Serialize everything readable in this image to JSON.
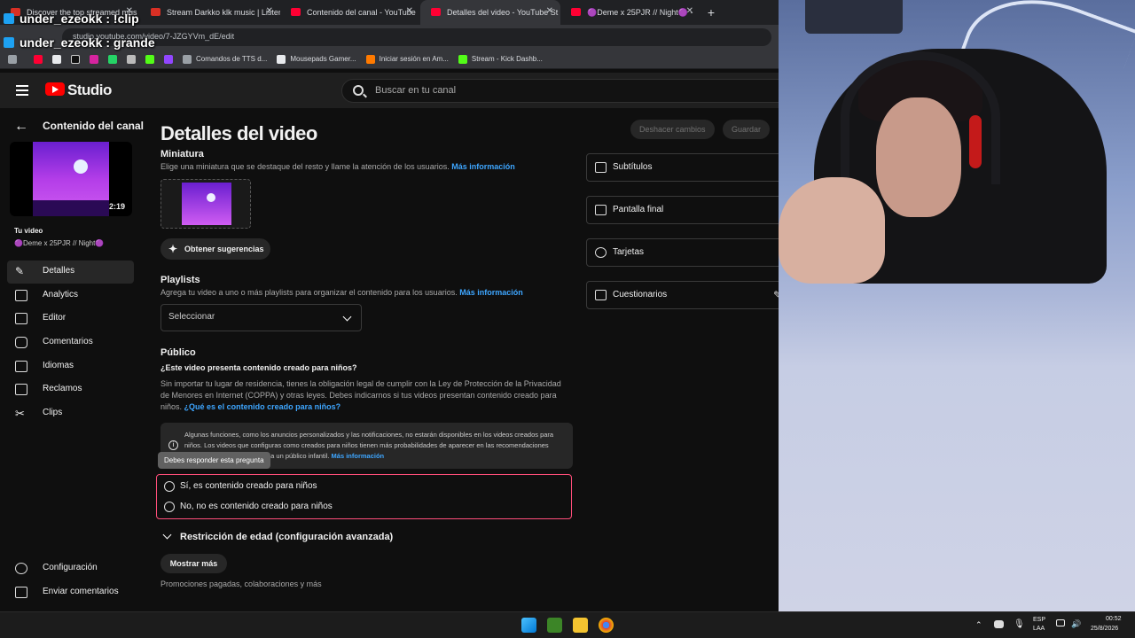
{
  "browser": {
    "tabs": [
      {
        "label": "Discover the top streamed mus",
        "color": "#d93025",
        "active": false
      },
      {
        "label": "Stream Darkko klk music | Listen",
        "color": "#d93025",
        "active": false
      },
      {
        "label": "Contenido del canal - YouTube",
        "color": "#ff0033",
        "active": false
      },
      {
        "label": "Detalles del video - YouTube St",
        "color": "#ff0033",
        "active": true
      },
      {
        "label": "🟣Deme x 25PJR // Night🟣 -",
        "color": "#ff0033",
        "active": false
      }
    ],
    "new_tab": "+",
    "url": "studio.youtube.com/video/7-JZGYVm_dE/edit",
    "bookmarks": [
      "Comandos de TTS d...",
      "Mousepads Gamer...",
      "Iniciar sesión en Am...",
      "Stream - Kick Dashb..."
    ]
  },
  "chat_overlay": [
    {
      "user": "under_ezeokk",
      "message": ": !clip"
    },
    {
      "user": "under_ezeokk",
      "message": ": grande"
    }
  ],
  "studio": {
    "logo_text": "Studio",
    "search_placeholder": "Buscar en tu canal",
    "sidebar": {
      "back_title": "Contenido del canal",
      "duration": "2:19",
      "your_video": "Tu video",
      "video_title": "🟣Deme x 25PJR // Night🟣",
      "nav": [
        {
          "label": "Detalles",
          "icon": "pencil-icon",
          "selected": true
        },
        {
          "label": "Analytics",
          "icon": "analytics-icon",
          "selected": false
        },
        {
          "label": "Editor",
          "icon": "editor-icon",
          "selected": false
        },
        {
          "label": "Comentarios",
          "icon": "comments-icon",
          "selected": false
        },
        {
          "label": "Idiomas",
          "icon": "subtitles-icon",
          "selected": false
        },
        {
          "label": "Reclamos",
          "icon": "copyright-icon",
          "selected": false
        },
        {
          "label": "Clips",
          "icon": "scissors-icon",
          "selected": false
        }
      ],
      "bottom": [
        {
          "label": "Configuración",
          "icon": "gear-icon"
        },
        {
          "label": "Enviar comentarios",
          "icon": "feedback-icon"
        }
      ]
    },
    "main": {
      "title": "Detalles del video",
      "undo_label": "Deshacer cambios",
      "save_label": "Guardar",
      "thumbnail": {
        "title": "Miniatura",
        "desc": "Elige una miniatura que se destaque del resto y llame la atención de los usuarios.",
        "link": "Más información",
        "suggestions_label": "Obtener sugerencias"
      },
      "playlists": {
        "title": "Playlists",
        "desc": "Agrega tu video a uno o más playlists para organizar el contenido para los usuarios.",
        "link": "Más información",
        "select_value": "Seleccionar"
      },
      "audience": {
        "title": "Público",
        "question": "¿Este video presenta contenido creado para niños?",
        "desc": "Sin importar tu lugar de residencia, tienes la obligación legal de cumplir con la Ley de Protección de la Privacidad de Menores en Internet (COPPA) y otras leyes. Debes indicarnos si tus videos presentan contenido creado para niños.",
        "link": "¿Qué es el contenido creado para niños?",
        "info_text": "Algunas funciones, como los anuncios personalizados y las notificaciones, no estarán disponibles en los videos creados para niños. Los videos que configuras como creados para niños tienen más probabilidades de aparecer en las recomendaciones junto a otros videos dirigidos a un público infantil.",
        "info_link": "Más información",
        "tooltip": "Debes responder esta pregunta",
        "option_yes": "Sí, es contenido creado para niños",
        "option_no": "No, no es contenido creado para niños"
      },
      "age_restriction": "Restricción de edad (configuración avanzada)",
      "show_more": "Mostrar más",
      "promotions": "Promociones pagadas, colaboraciones y más"
    },
    "cards": [
      {
        "label": "Subtítulos",
        "icon": "subtitles-icon"
      },
      {
        "label": "Pantalla final",
        "icon": "end-screen-icon"
      },
      {
        "label": "Tarjetas",
        "icon": "info-icon"
      },
      {
        "label": "Cuestionarios",
        "icon": "quiz-icon"
      }
    ]
  },
  "taskbar": {
    "lang": "ESP",
    "layout": "LAA",
    "time": "00:52",
    "date": "25/8/2026"
  }
}
